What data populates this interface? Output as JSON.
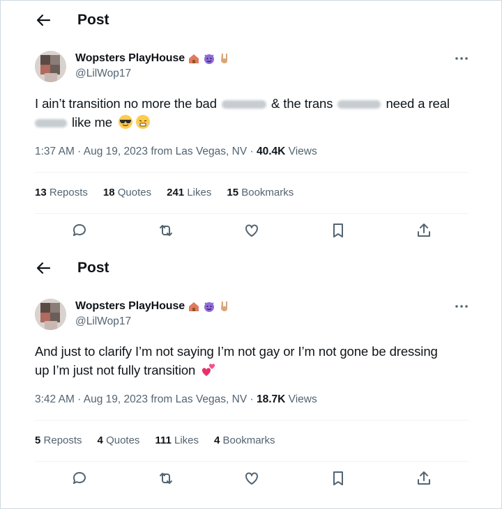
{
  "posts": [
    {
      "header_title": "Post",
      "author_name": "Wopsters PlayHouse",
      "handle": "@LilWop17",
      "text_parts": [
        "I ain’t transition no more the bad",
        "& the trans",
        "need a real",
        "like me"
      ],
      "time": "1:37 AM",
      "date": "Aug 19, 2023",
      "location": "from Las Vegas, NV",
      "views_count": "40.4K",
      "views_label": "Views",
      "reposts_count": "13",
      "reposts_label": "Reposts",
      "quotes_count": "18",
      "quotes_label": "Quotes",
      "likes_count": "241",
      "likes_label": "Likes",
      "bookmarks_count": "15",
      "bookmarks_label": "Bookmarks"
    },
    {
      "header_title": "Post",
      "author_name": "Wopsters PlayHouse",
      "handle": "@LilWop17",
      "text_line1": "And just to clarify I’m not saying I’m not gay or I’m not gone be dressing",
      "text_line2": "up I’m just not fully transition",
      "time": "3:42 AM",
      "date": "Aug 19, 2023",
      "location": "from Las Vegas, NV",
      "views_count": "18.7K",
      "views_label": "Views",
      "reposts_count": "5",
      "reposts_label": "Reposts",
      "quotes_count": "4",
      "quotes_label": "Quotes",
      "likes_count": "111",
      "likes_label": "Likes",
      "bookmarks_count": "4",
      "bookmarks_label": "Bookmarks"
    }
  ],
  "icons": [
    "back-arrow-icon",
    "more-icon",
    "reply-icon",
    "repost-icon",
    "like-icon",
    "bookmark-icon",
    "share-icon"
  ],
  "colors": {
    "text": "#0f1419",
    "secondary": "#536471",
    "divider": "#eff3f4"
  }
}
